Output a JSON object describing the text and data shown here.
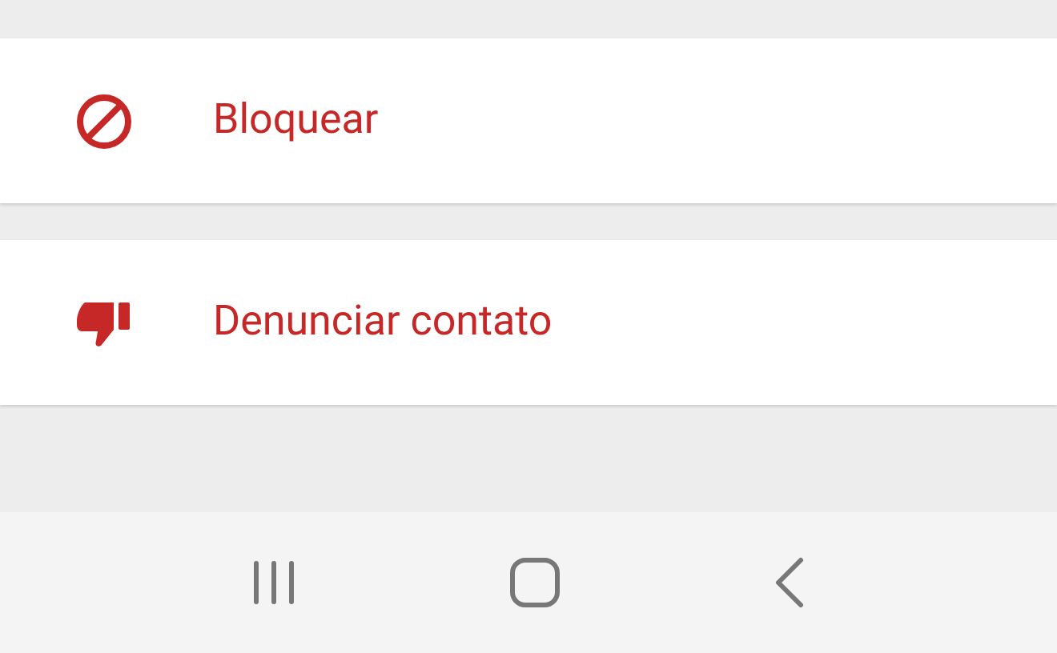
{
  "menu_items": [
    {
      "kind": "block",
      "label": "Bloquear"
    },
    {
      "kind": "report",
      "label": "Denunciar contato"
    }
  ]
}
